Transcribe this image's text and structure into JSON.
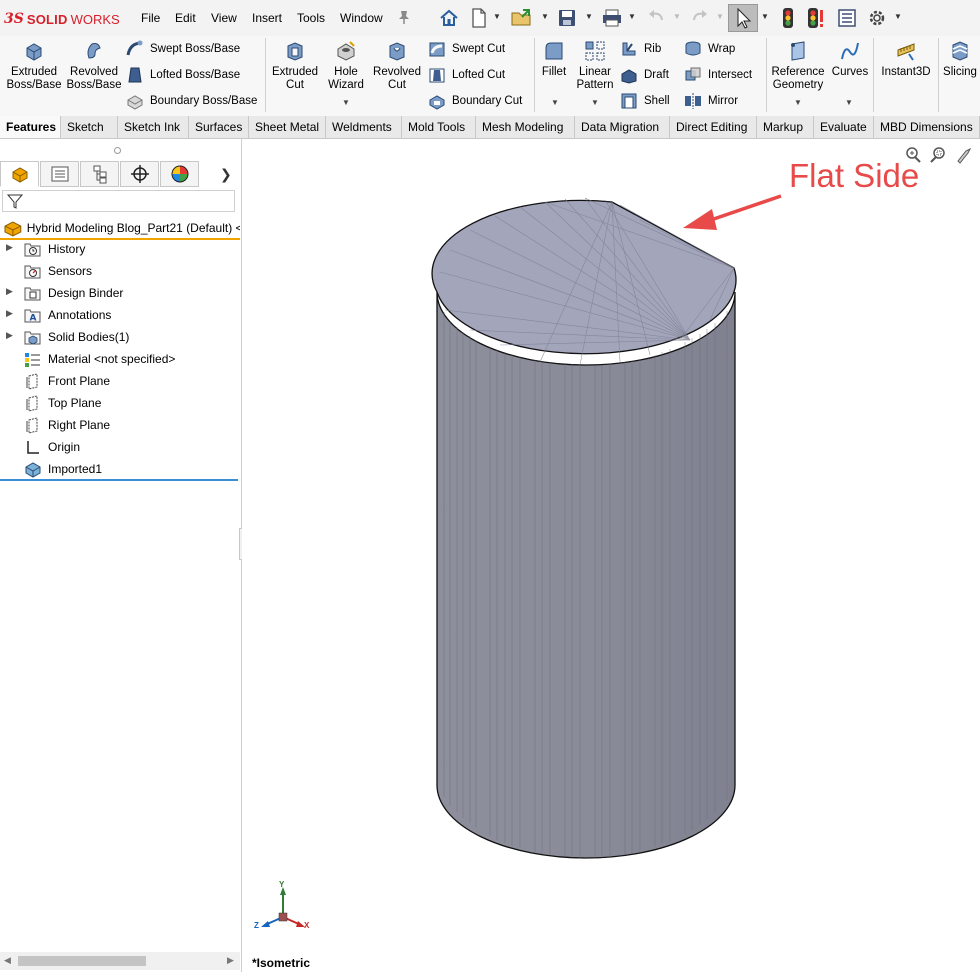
{
  "app": {
    "logo_prefix": "3S",
    "logo_name": "SOLID",
    "logo_suffix": "WORKS"
  },
  "menu": {
    "items": [
      "File",
      "Edit",
      "View",
      "Insert",
      "Tools",
      "Window"
    ]
  },
  "command_manager": {
    "features_large": [
      {
        "label1": "Extruded",
        "label2": "Boss/Base"
      },
      {
        "label1": "Revolved",
        "label2": "Boss/Base"
      }
    ],
    "features_small": [
      "Swept Boss/Base",
      "Lofted Boss/Base",
      "Boundary Boss/Base"
    ],
    "cut_large": [
      {
        "label1": "Extruded",
        "label2": "Cut"
      },
      {
        "label1": "Hole",
        "label2": "Wizard"
      },
      {
        "label1": "Revolved",
        "label2": "Cut"
      }
    ],
    "cut_small": [
      "Swept Cut",
      "Lofted Cut",
      "Boundary Cut"
    ],
    "fillet": "Fillet",
    "linear_pattern": {
      "label1": "Linear",
      "label2": "Pattern"
    },
    "mid_small": [
      "Rib",
      "Draft",
      "Shell"
    ],
    "right_small": [
      "Wrap",
      "Intersect",
      "Mirror"
    ],
    "reference_geometry": {
      "label1": "Reference",
      "label2": "Geometry"
    },
    "curves": "Curves",
    "instant3d": "Instant3D",
    "slicing": "Slicing"
  },
  "tabs": [
    "Features",
    "Sketch",
    "Sketch Ink",
    "Surfaces",
    "Sheet Metal",
    "Weldments",
    "Mold Tools",
    "Mesh Modeling",
    "Data Migration",
    "Direct Editing",
    "Markup",
    "Evaluate",
    "MBD Dimensions"
  ],
  "feature_tree": {
    "root": "Hybrid Modeling Blog_Part21 (Default) <",
    "items": [
      {
        "label": "History",
        "expandable": true
      },
      {
        "label": "Sensors",
        "expandable": false
      },
      {
        "label": "Design Binder",
        "expandable": true
      },
      {
        "label": "Annotations",
        "expandable": true
      },
      {
        "label": "Solid Bodies(1)",
        "expandable": true
      },
      {
        "label": "Material <not specified>",
        "expandable": false
      },
      {
        "label": "Front Plane",
        "expandable": false
      },
      {
        "label": "Top Plane",
        "expandable": false
      },
      {
        "label": "Right Plane",
        "expandable": false
      },
      {
        "label": "Origin",
        "expandable": false
      },
      {
        "label": "Imported1",
        "expandable": false
      }
    ]
  },
  "viewport": {
    "view_orientation": "*Isometric",
    "annotation": "Flat Side",
    "triad": {
      "y": "Y",
      "x": "X",
      "z": "Z"
    }
  },
  "colors": {
    "accent_red": "#e84a4a",
    "brand_red": "#d8202b",
    "tree_marker": "#f0a400",
    "body_gray": "#8a8c99"
  }
}
